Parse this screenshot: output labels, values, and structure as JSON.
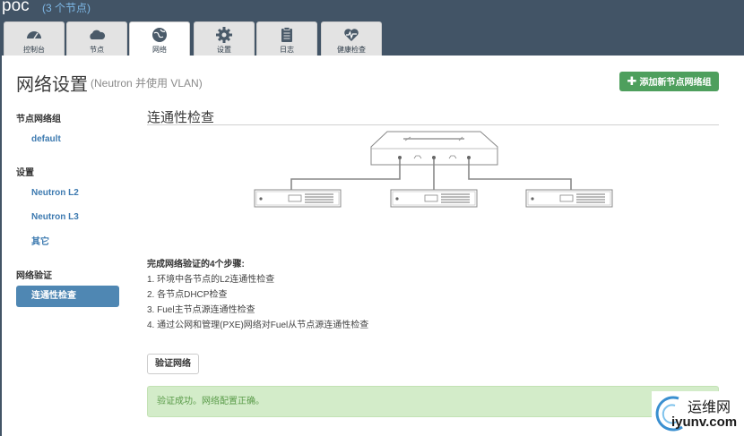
{
  "environment": {
    "name": "poc",
    "nodes_count": "(3 个节点)"
  },
  "tabs": [
    {
      "label": "控制台",
      "icon": "dashboard-icon"
    },
    {
      "label": "节点",
      "icon": "cloud-icon"
    },
    {
      "label": "网络",
      "icon": "globe-icon",
      "active": true
    },
    {
      "label": "设置",
      "icon": "gear-icon"
    },
    {
      "label": "日志",
      "icon": "clipboard-icon"
    },
    {
      "label": "健康检查",
      "icon": "heart-pulse-icon"
    }
  ],
  "page": {
    "title": "网络设置",
    "subtitle": "(Neutron 并使用 VLAN)",
    "add_button": "添加新节点网络组"
  },
  "sidebar": {
    "groups": [
      {
        "title": "节点网络组",
        "items": [
          {
            "label": "default"
          }
        ]
      },
      {
        "title": "设置",
        "items": [
          {
            "label": "Neutron L2"
          },
          {
            "label": "Neutron L3"
          },
          {
            "label": "其它"
          }
        ]
      },
      {
        "title": "网络验证",
        "items": [
          {
            "label": "连通性检查",
            "active": true
          }
        ]
      }
    ]
  },
  "connectivity": {
    "title": "连通性检查",
    "steps_title": "完成网络验证的4个步骤:",
    "steps": [
      "1. 环境中各节点的L2连通性检查",
      "2. 各节点DHCP检查",
      "3. Fuel主节点源连通性检查",
      "4. 通过公网和管理(PXE)网络对Fuel从节点源连通性检查"
    ],
    "verify_button": "验证网络",
    "result": "验证成功。网络配置正确。"
  },
  "watermark": {
    "line1": "运维网",
    "line2": "iyunv.com"
  },
  "colors": {
    "header_bg": "#425466",
    "accent_green": "#4e9f5d",
    "active_blue": "#4f87b3",
    "success_bg": "#d3ecc9"
  }
}
